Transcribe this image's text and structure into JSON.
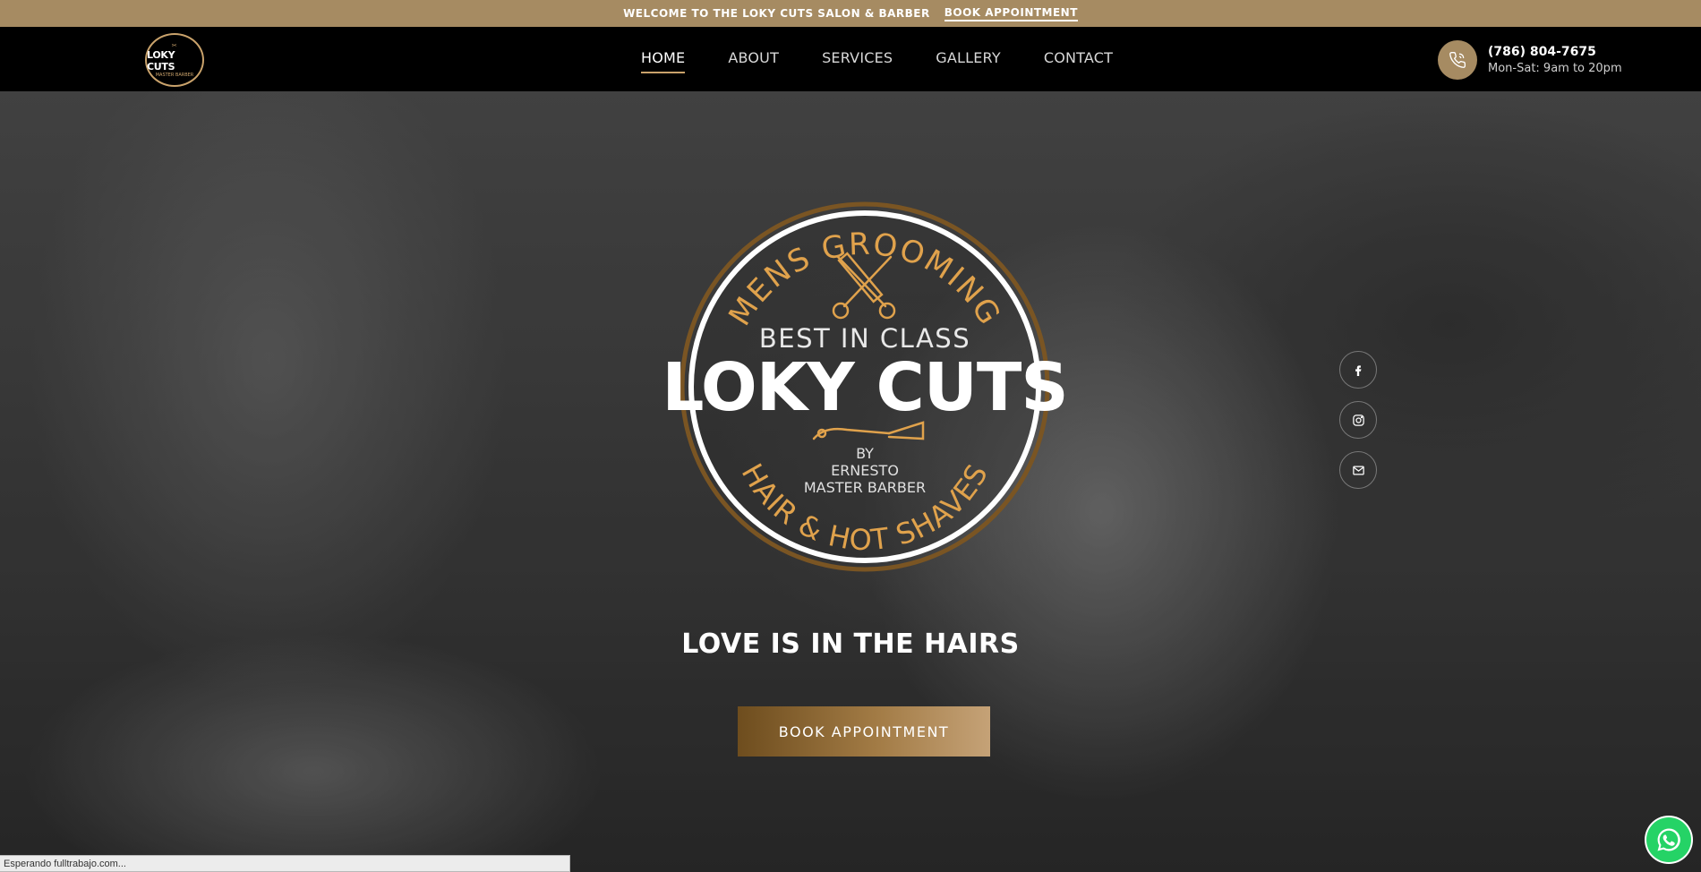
{
  "topbar": {
    "welcome_text": "WELCOME TO THE LOKY CUTS SALON & BARBER",
    "book_link": "BOOK APPOINTMENT"
  },
  "header": {
    "logo_top": "✂",
    "logo_text": "LOKY CUTS",
    "logo_sub": "MASTER BARBER",
    "nav": [
      "HOME",
      "ABOUT",
      "SERVICES",
      "GALLERY",
      "CONTACT"
    ],
    "active_nav": "HOME",
    "phone": "(786) 804-7675",
    "hours": "Mon-Sat: 9am to 20pm",
    "phone_icon": "phone-icon"
  },
  "hero": {
    "badge": {
      "arc_top": "MENS GROOMING",
      "best": "BEST IN CLASS",
      "brand": "LOKY CUTS",
      "by": "BY",
      "name_line1": "ERNESTO",
      "name_line2": "MASTER BARBER",
      "arc_bottom": "HAIR & HOT SHAVES"
    },
    "tagline": "LOVE IS IN THE HAIRS",
    "cta": "BOOK APPOINTMENT"
  },
  "social": [
    "facebook-icon",
    "instagram-icon",
    "email-icon"
  ],
  "whatsapp_icon": "whatsapp-icon",
  "status_text": "Esperando fulltrabajo.com...",
  "colors": {
    "gold": "#a68b62",
    "gold_light": "#e0a24c",
    "black": "#000000"
  }
}
